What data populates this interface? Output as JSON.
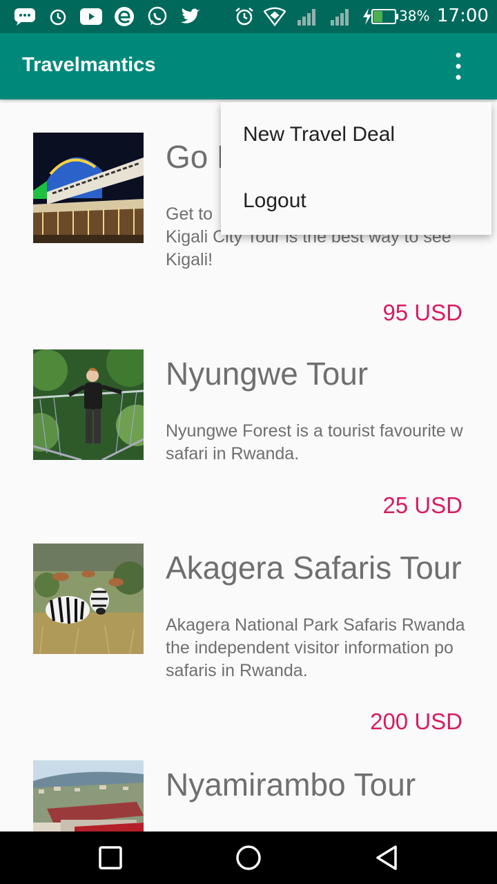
{
  "status_bar": {
    "battery": "38%",
    "time": "17:00",
    "notification_icons": [
      "sms-icon",
      "alarm-icon",
      "youtube-icon",
      "edge-icon",
      "whatsapp-icon",
      "twitter-icon"
    ],
    "system_icons": [
      "alarm-icon",
      "wifi-icon",
      "signal-icon",
      "signal-icon",
      "charging-icon",
      "battery-icon"
    ]
  },
  "app_bar": {
    "title": "Travelmantics",
    "overflow_icon": "more-vert-icon"
  },
  "menu": {
    "items": [
      {
        "label": "New Travel Deal"
      },
      {
        "label": "Logout"
      }
    ]
  },
  "deals": [
    {
      "title": "Go Kigali City Tour",
      "title_visible": "Go K",
      "description_lines": [
        "Get to",
        "Kigali City Tour is the best way to see",
        "Kigali!"
      ],
      "price": "95 USD",
      "image": "kigali-convention-centre-photo"
    },
    {
      "title": "Nyungwe Tour",
      "description_lines": [
        "Nyungwe Forest is a tourist favourite w",
        "safari in Rwanda."
      ],
      "price": "25 USD",
      "image": "canopy-walkway-photo"
    },
    {
      "title": "Akagera Safaris Tour",
      "description_lines": [
        "Akagera National Park Safaris Rwanda",
        "the independent visitor information po",
        "safaris in Rwanda."
      ],
      "price": "200 USD",
      "image": "zebras-photo"
    },
    {
      "title": "Nyamirambo Tour",
      "description_lines": [],
      "price": "",
      "image": "nyamirambo-town-photo"
    }
  ],
  "colors": {
    "primary": "#00897b",
    "primary_dark": "#00695c",
    "accent": "#d81b60",
    "text_secondary": "#6f6f6f"
  },
  "nav_bar": {
    "icons": [
      "recents-icon",
      "home-icon",
      "back-icon"
    ]
  }
}
